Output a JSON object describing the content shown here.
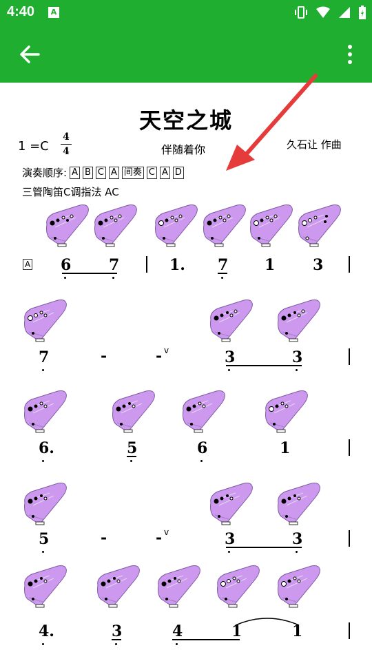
{
  "status_bar": {
    "time": "4:40",
    "notif": "A"
  },
  "header": {
    "title": "天空之城",
    "key_signature": "1 =C",
    "time_sig_top": "4",
    "time_sig_bottom": "4",
    "subtitle": "伴随着你",
    "composer": "久石让  作曲"
  },
  "order": {
    "label": "演奏顺序:",
    "items": [
      "A",
      "B",
      "C",
      "A",
      "间奏",
      "C",
      "A",
      "D"
    ]
  },
  "fingering_label": "三管陶笛C调指法 AC",
  "score": {
    "row1": {
      "section": "A",
      "notes": [
        "6",
        "7",
        "1.",
        "7",
        "1",
        "3"
      ]
    },
    "row2": {
      "notes": [
        "7",
        "-",
        "-",
        "3",
        "3"
      ]
    },
    "row3": {
      "notes": [
        "6.",
        "5",
        "6",
        "1"
      ]
    },
    "row4": {
      "notes": [
        "5",
        "-",
        "-",
        "3",
        "3"
      ]
    },
    "row5": {
      "notes": [
        "4.",
        "3",
        "4",
        "1",
        "1"
      ]
    }
  },
  "colors": {
    "appbar": "#1fae2f",
    "ocarina": "#cc99ee",
    "arrow": "#e63b3b"
  }
}
